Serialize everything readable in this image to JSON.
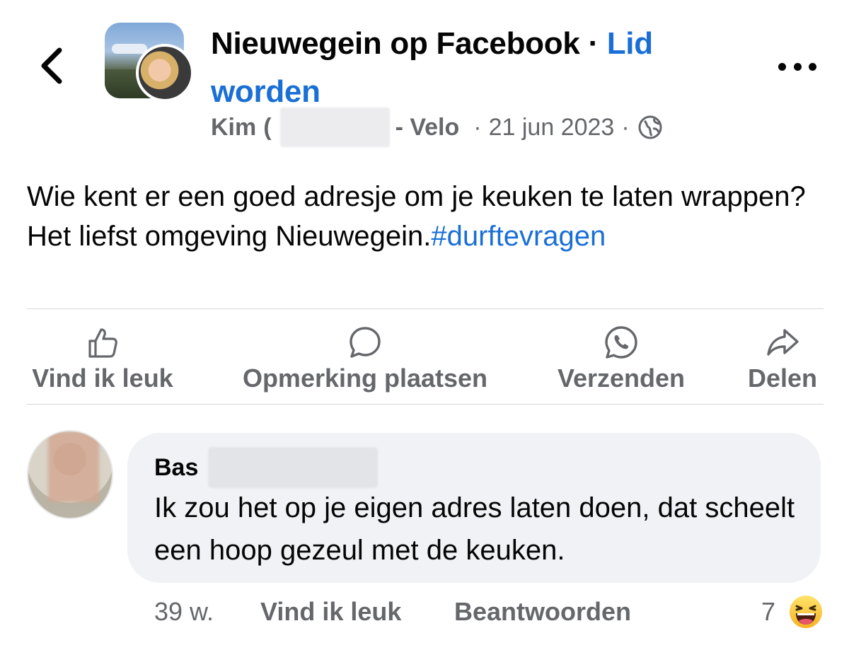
{
  "header": {
    "group_name": "Nieuwegein op Facebook",
    "separator": "·",
    "join_label": "Lid worden",
    "back_icon": "chevron-left-icon",
    "more_icon": "more-horizontal-icon"
  },
  "post": {
    "author_first": "Kim",
    "author_partial": "(",
    "author_suffix": "- Velo",
    "date": "21 jun 2023",
    "meta_separator": "·",
    "privacy_icon": "globe-icon",
    "text": "Wie kent er een goed adresje om je keuken te laten wrappen? Het liefst omgeving Nieuwegein.",
    "hashtag": "#durftevragen"
  },
  "actions": [
    {
      "label": "Vind ik leuk",
      "icon": "thumbs-up-icon"
    },
    {
      "label": "Opmerking plaatsen",
      "icon": "comment-icon"
    },
    {
      "label": "Verzenden",
      "icon": "whatsapp-icon"
    },
    {
      "label": "Delen",
      "icon": "share-icon"
    }
  ],
  "comment": {
    "author_first": "Bas",
    "text": "Ik zou het op je eigen adres laten doen, dat scheelt een hoop gezeul met de keuken.",
    "age": "39 w.",
    "like_label": "Vind ik leuk",
    "reply_label": "Beantwoorden",
    "reaction_count": "7",
    "reaction_icon": "haha-emoji-icon"
  },
  "colors": {
    "link_blue": "#1a6fd6",
    "secondary_text": "#65676b",
    "bubble_bg": "#f0f2f5"
  }
}
